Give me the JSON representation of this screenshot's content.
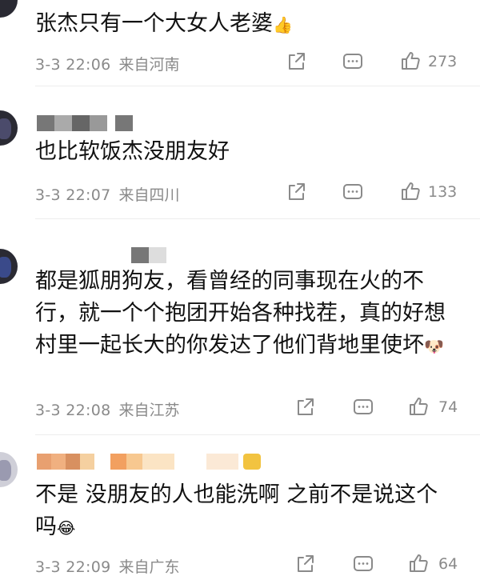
{
  "comments": [
    {
      "text": "张杰只有一个大女人老婆",
      "emoji": "👍",
      "time": "3-3 22:06",
      "location": "来自河南",
      "likes": "273"
    },
    {
      "text": "也比软饭杰没朋友好",
      "emoji": "",
      "time": "3-3 22:07",
      "location": "来自四川",
      "likes": "133"
    },
    {
      "text": "都是狐朋狗友，看曾经的同事现在火的不行，就一个个抱团开始各种找茬，真的好想村里一起长大的你发达了他们背地里使坏",
      "emoji": "🐶",
      "time": "3-3 22:08",
      "location": "来自江苏",
      "likes": "74"
    },
    {
      "text": "不是 没朋友的人也能洗啊 之前不是说这个吗",
      "emoji": "😂",
      "time": "3-3 22:09",
      "location": "来自广东",
      "likes": "64"
    }
  ],
  "icons": {
    "share": "share-icon",
    "comment": "comment-icon",
    "like": "thumbs-up-icon"
  },
  "colors": {
    "text": "#111111",
    "meta": "#8a8a8a",
    "divider": "#ececec"
  }
}
